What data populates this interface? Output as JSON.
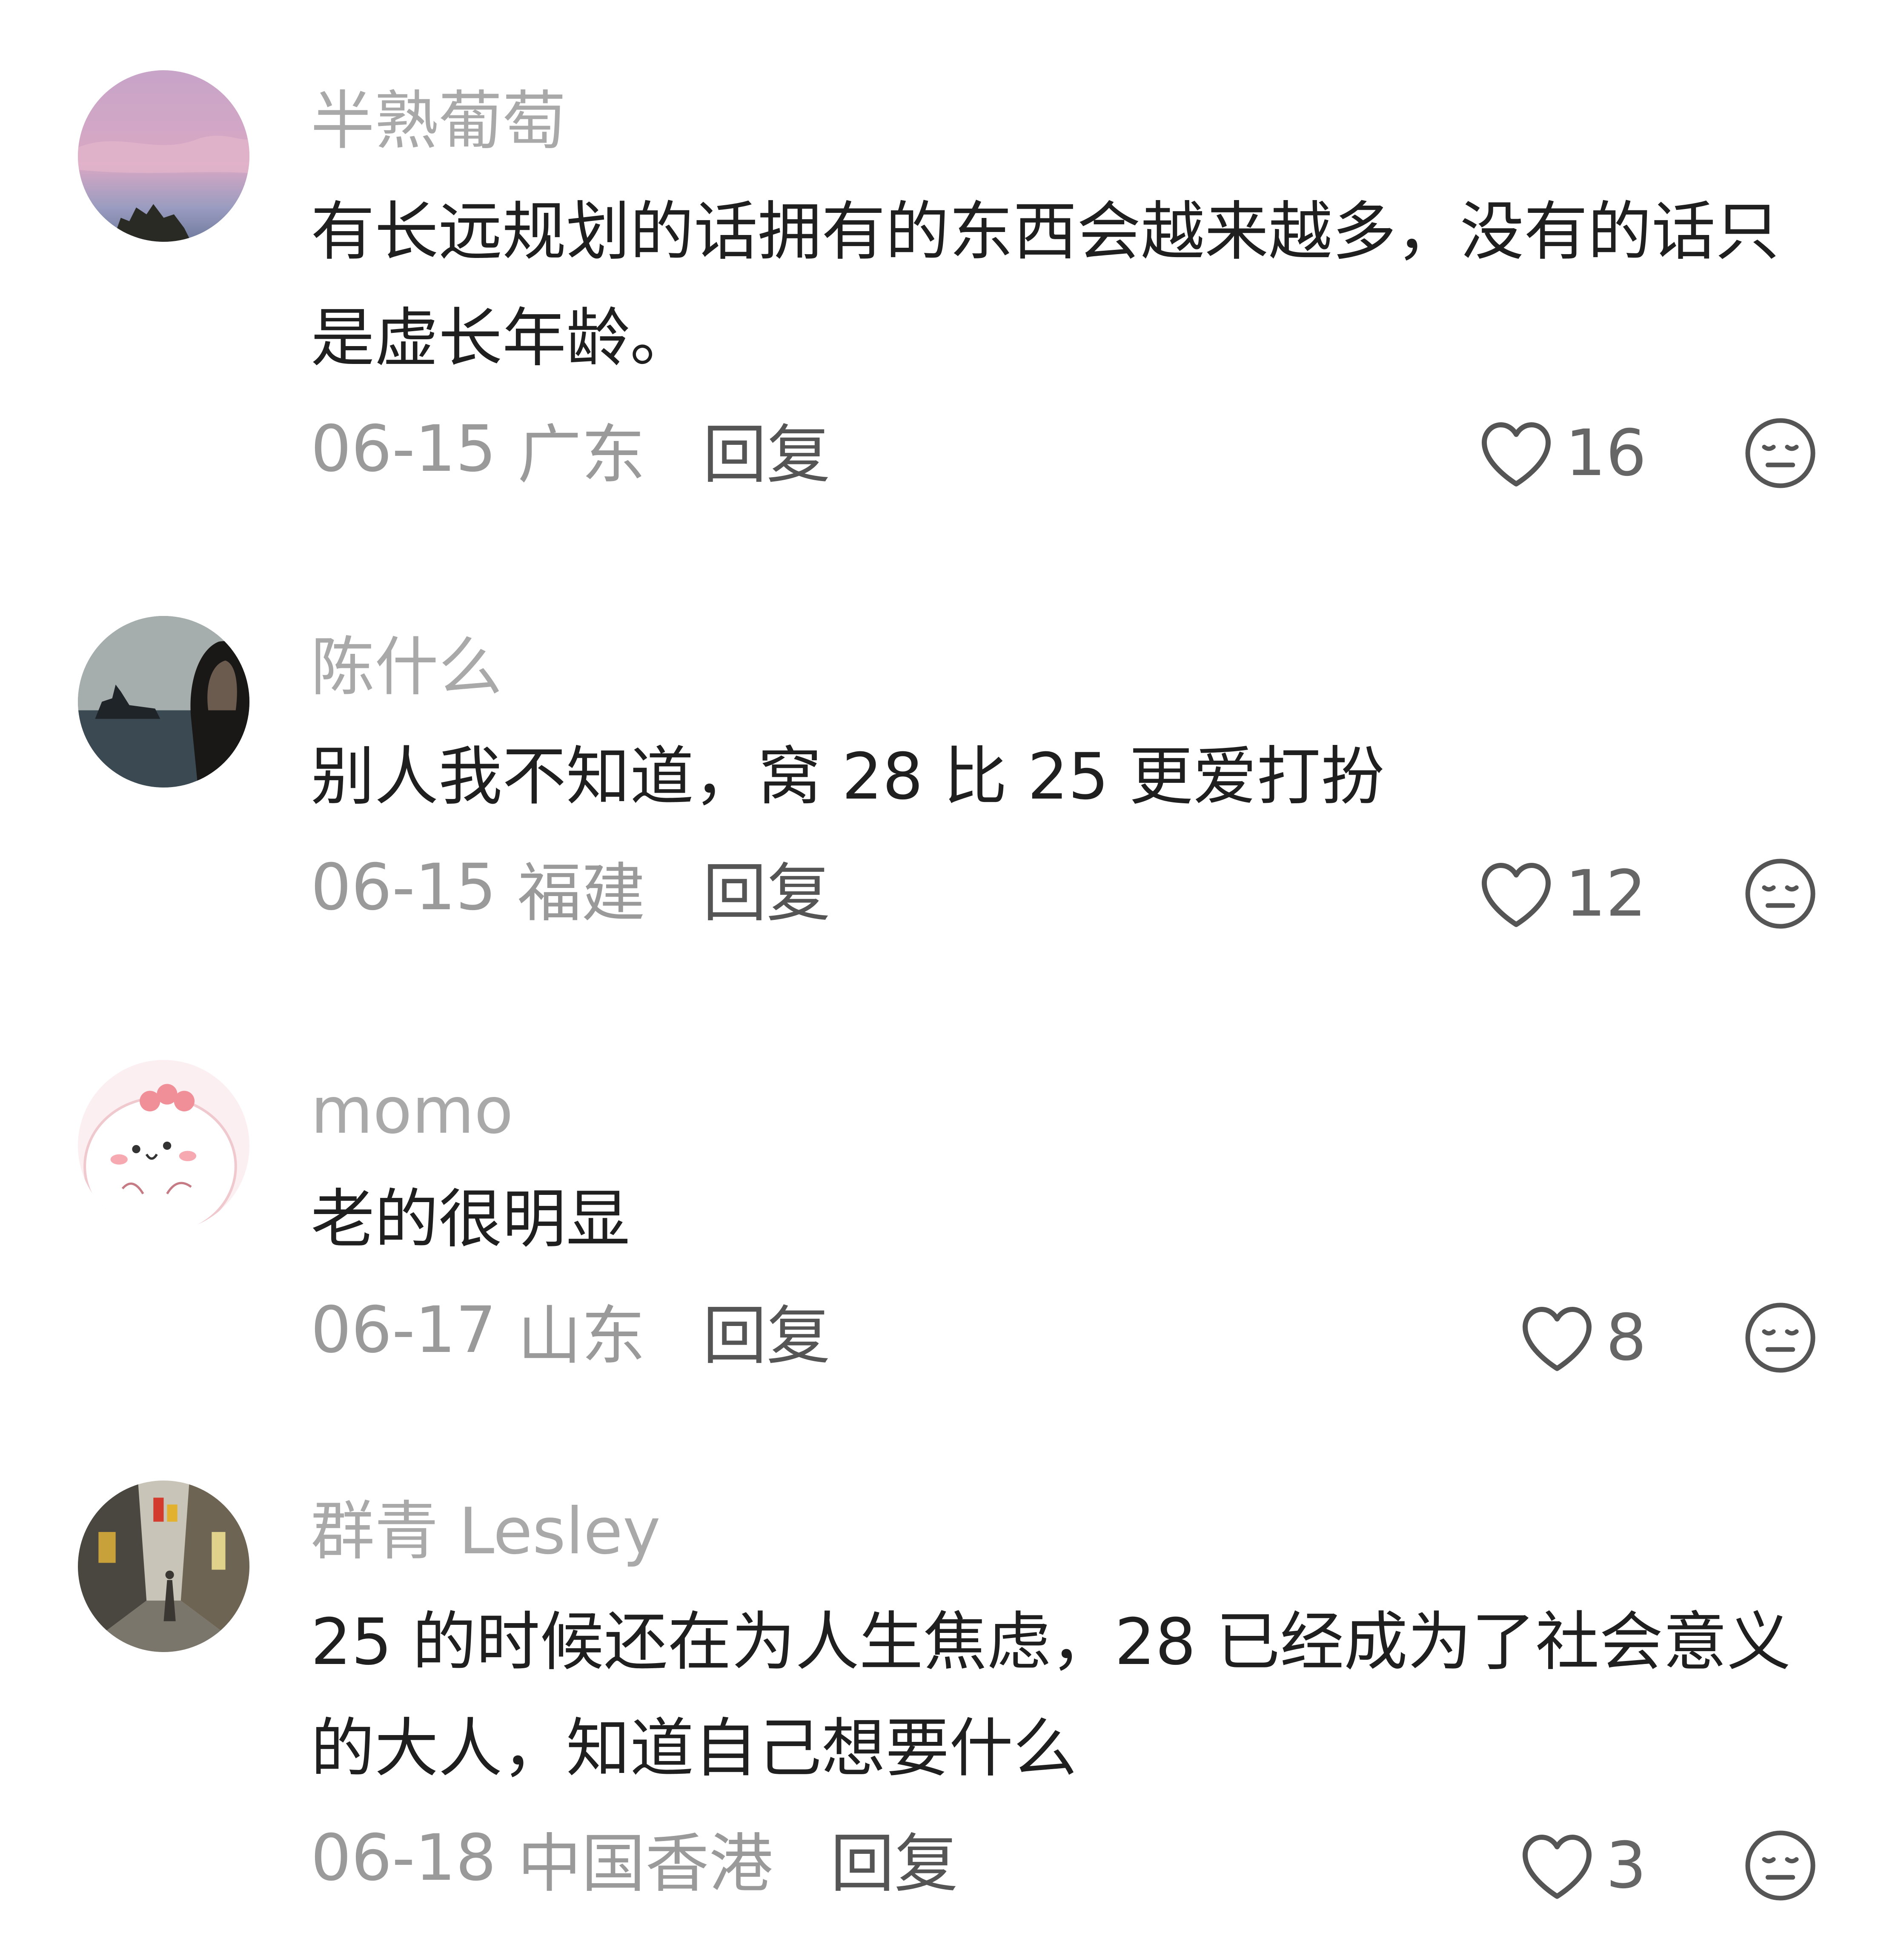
{
  "comments": [
    {
      "username": "半熟葡萄",
      "text": "有长远规划的话拥有的东西会越来越多，没有的话只是虚长年龄。",
      "date": "06-15",
      "region": "广东",
      "reply_label": "回复",
      "likes": "16"
    },
    {
      "username": "陈什么",
      "text": "别人我不知道，窝 28 比 25 更爱打扮",
      "date": "06-15",
      "region": "福建",
      "reply_label": "回复",
      "likes": "12"
    },
    {
      "username": "momo",
      "text": "老的很明显",
      "date": "06-17",
      "region": "山东",
      "reply_label": "回复",
      "likes": "8"
    },
    {
      "username": "群青 Lesley",
      "text": "25 的时候还在为人生焦虑，28 已经成为了社会意义的大人，知道自己想要什么",
      "date": "06-18",
      "region": "中国香港",
      "reply_label": "回复",
      "likes": "3"
    }
  ],
  "icons": {
    "like": "heart-icon",
    "dislike": "dislike-face-icon"
  },
  "colors": {
    "username": "#a9a9a9",
    "content": "#1f1f1f",
    "meta": "#9a9a9a",
    "reply": "#555555",
    "icon": "#555555"
  }
}
